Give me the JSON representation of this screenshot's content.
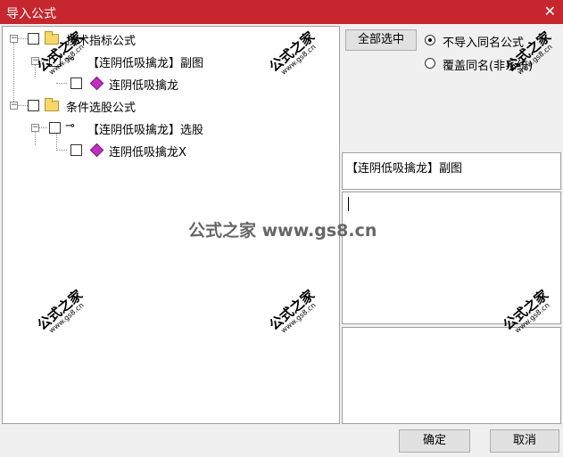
{
  "window": {
    "title": "导入公式",
    "close_symbol": "✕"
  },
  "tree": {
    "groups": [
      {
        "label": "技术指标公式",
        "items": [
          {
            "label": "【连阴低吸擒龙】副图",
            "children": [
              {
                "label": "连阴低吸擒龙"
              }
            ]
          }
        ]
      },
      {
        "label": "条件选股公式",
        "items": [
          {
            "label": "【连阴低吸擒龙】选股",
            "children": [
              {
                "label": "连阴低吸擒龙X"
              }
            ]
          }
        ]
      }
    ]
  },
  "buttons": {
    "select_all": "全部选中",
    "ok": "确定",
    "cancel": "取消"
  },
  "options": [
    {
      "label": "不导入同名公式",
      "selected": true
    },
    {
      "label": "覆盖同名(非系统)",
      "selected": false
    }
  ],
  "description": "【连阴低吸擒龙】副图",
  "watermark": {
    "name": "公式之家",
    "url": "www.gs8.cn",
    "center": "公式之家 www.gs8.cn"
  },
  "colors": {
    "title_bar": "#c6262e",
    "folder": "#f6d76a",
    "formula_gem": "#c030c0"
  }
}
